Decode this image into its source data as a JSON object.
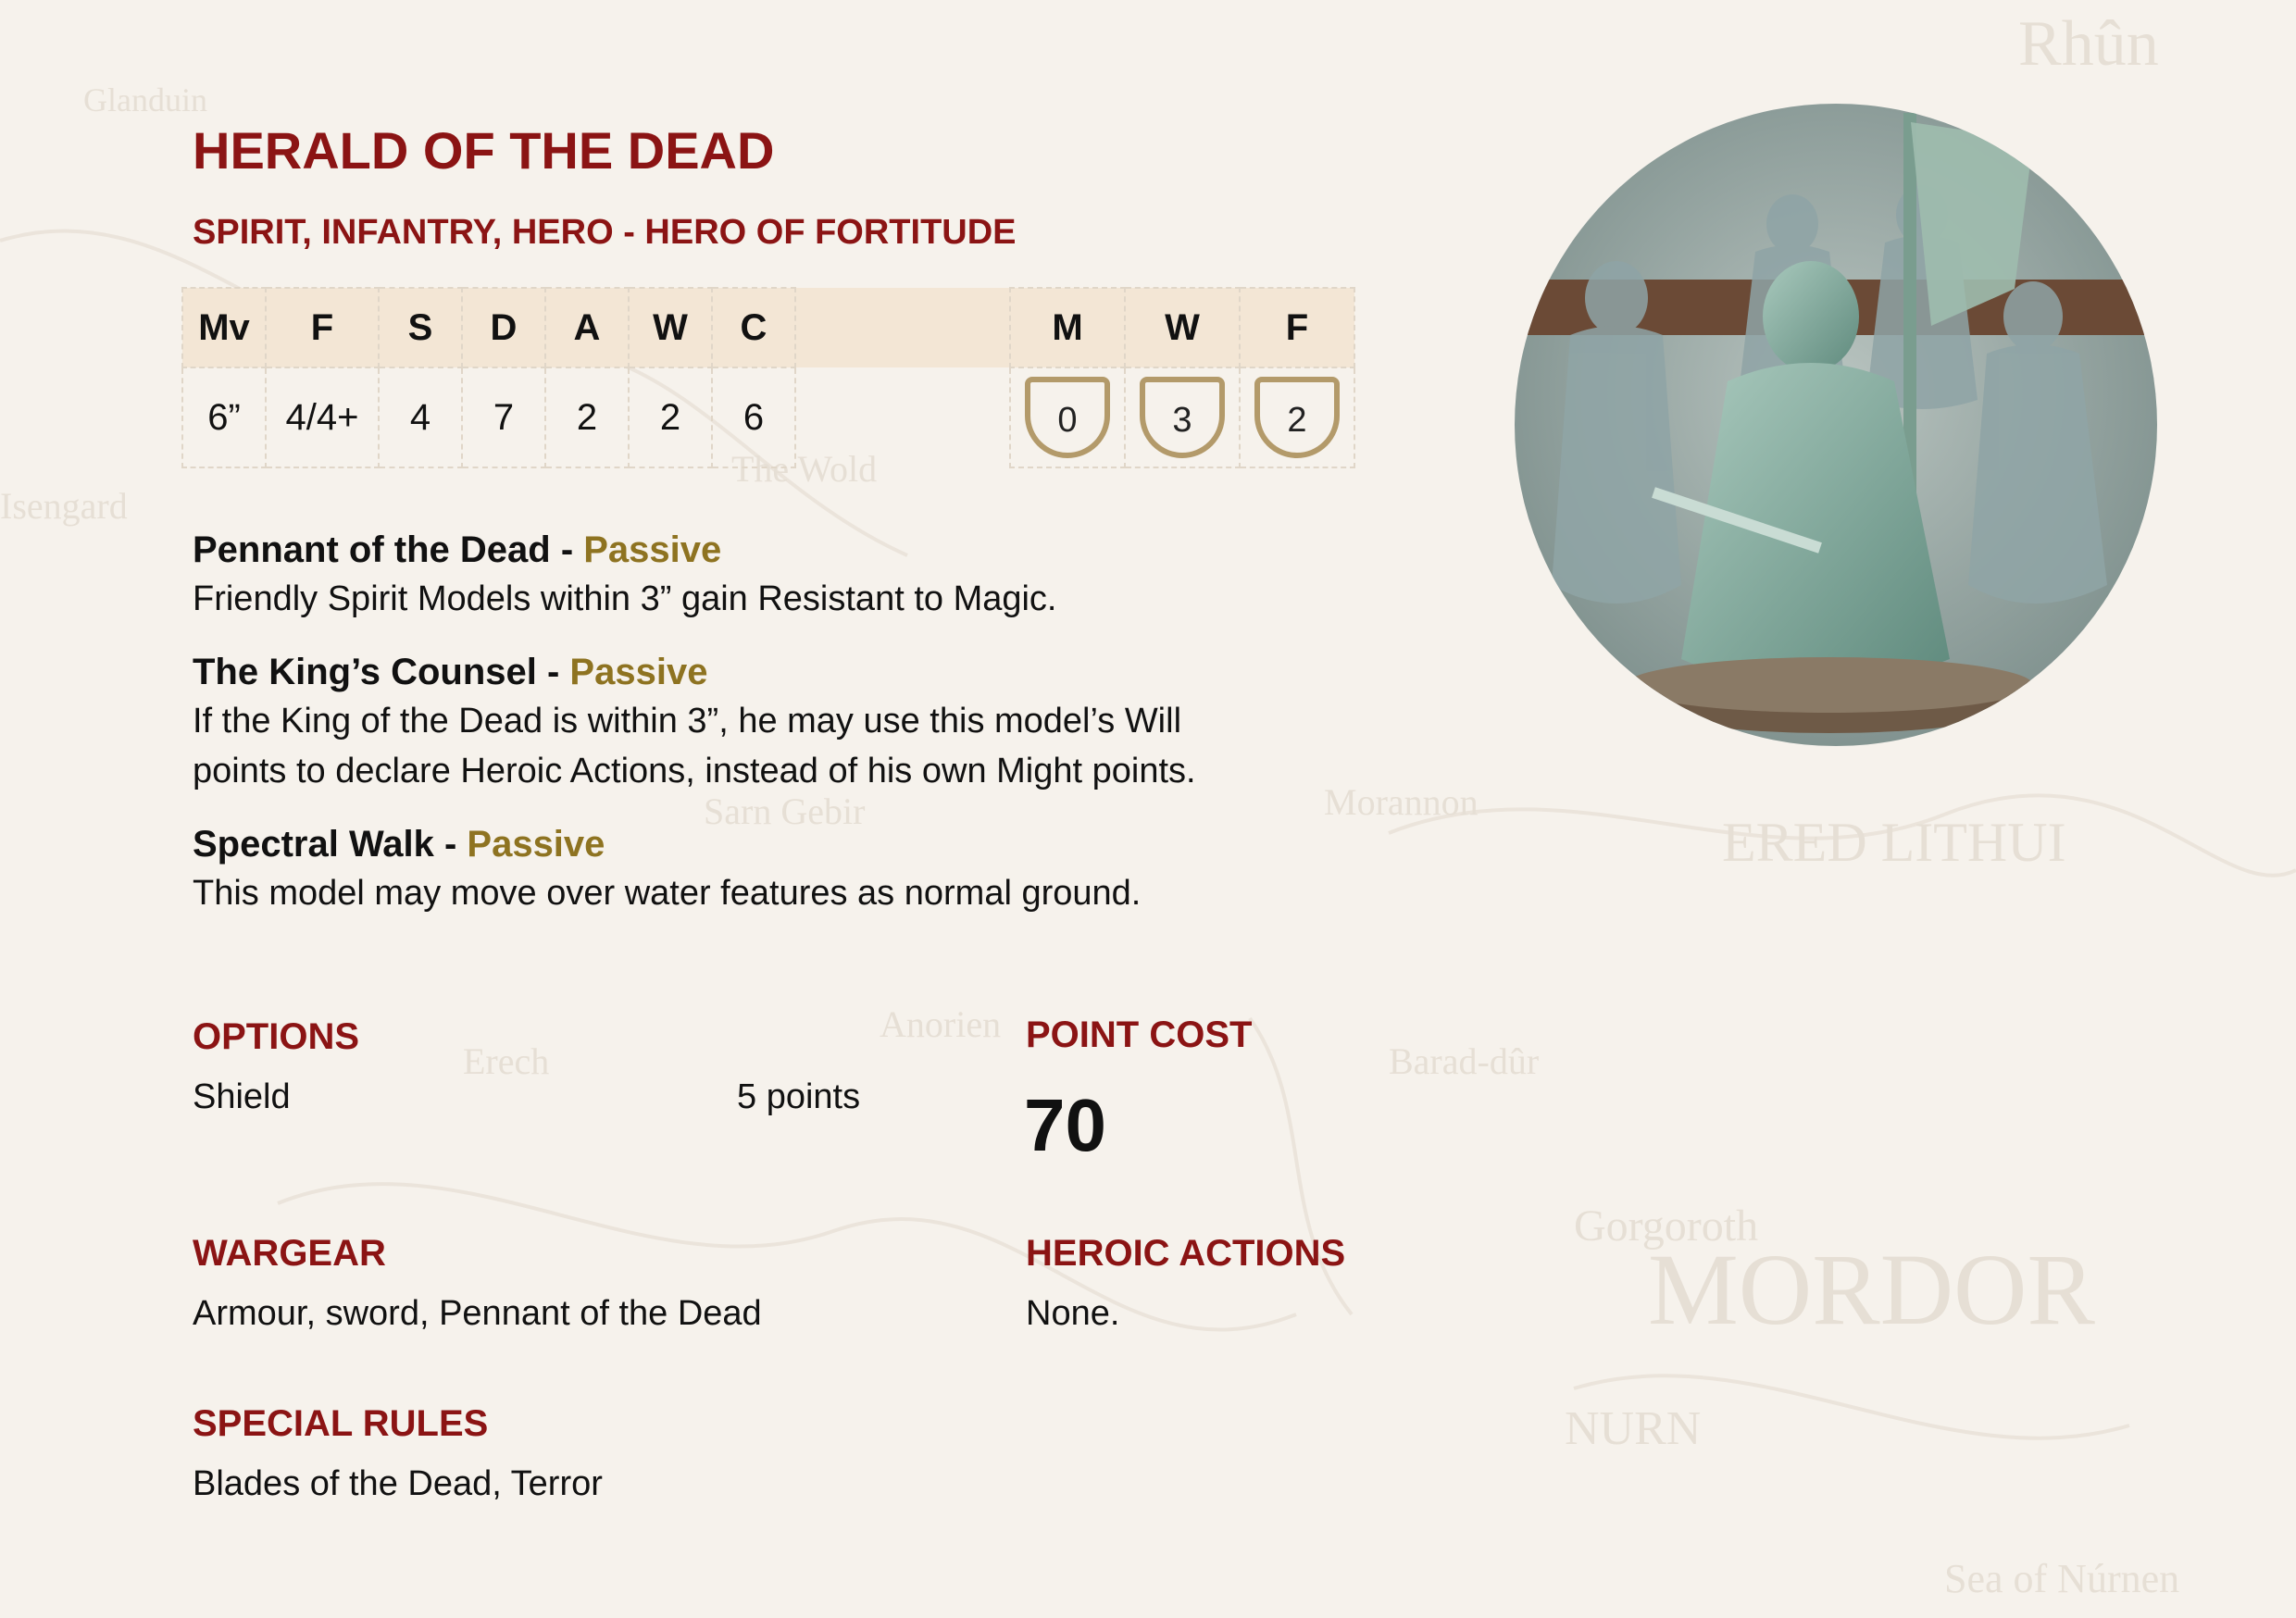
{
  "unit": {
    "name": "HERALD OF THE DEAD",
    "keywords": "SPIRIT, INFANTRY, HERO - HERO OF FORTITUDE"
  },
  "stats": {
    "headers": [
      "Mv",
      "F",
      "S",
      "D",
      "A",
      "W",
      "C"
    ],
    "values": [
      "6”",
      "4/4+",
      "4",
      "7",
      "2",
      "2",
      "6"
    ]
  },
  "hero_stats": {
    "headers": [
      "M",
      "W",
      "F"
    ],
    "values": [
      "0",
      "3",
      "2"
    ]
  },
  "special_abilities": [
    {
      "name": "Pennant of the Dead",
      "separator": " - ",
      "type": "Passive",
      "lines": [
        "Friendly Spirit Models within 3” gain Resistant to Magic."
      ]
    },
    {
      "name": "The King’s Counsel",
      "separator": " - ",
      "type": "Passive",
      "lines": [
        "If the King of the Dead is within 3”, he may use this model’s Will",
        "points to declare Heroic Actions, instead of his own Might points."
      ]
    },
    {
      "name": "Spectral Walk",
      "separator": " - ",
      "type": "Passive",
      "lines": [
        "This model may move over water features as normal ground."
      ]
    }
  ],
  "options": {
    "heading": "OPTIONS",
    "items": [
      {
        "name": "Shield",
        "cost": "5 points"
      }
    ]
  },
  "point_cost": {
    "heading": "POINT COST",
    "value": "70"
  },
  "wargear": {
    "heading": "WARGEAR",
    "text": "Armour, sword, Pennant of the Dead"
  },
  "heroic_actions": {
    "heading": "HEROIC ACTIONS",
    "text": "None."
  },
  "special_rules": {
    "heading": "SPECIAL RULES",
    "text": "Blades of the Dead, Terror"
  },
  "background_map_labels": [
    "Rhûn",
    "Glanduin",
    "ERED LITHUI",
    "MORDOR",
    "Gorgoroth",
    "NURN",
    "Sea of Núrnen",
    "Isengard",
    "Barad-dûr",
    "Morannon",
    "Sarn Gebir",
    "The Wold",
    "Erech",
    "Anorien"
  ],
  "colors": {
    "heading_red": "#8b1414",
    "passive_gold": "#8e7321",
    "table_header_bg": "#f3e6d5",
    "shield_border": "#b39a6a",
    "page_bg": "#f6f2ec"
  },
  "icons": {
    "portrait": "miniature-portrait-image",
    "stat_shield": "shield-badge-icon"
  }
}
